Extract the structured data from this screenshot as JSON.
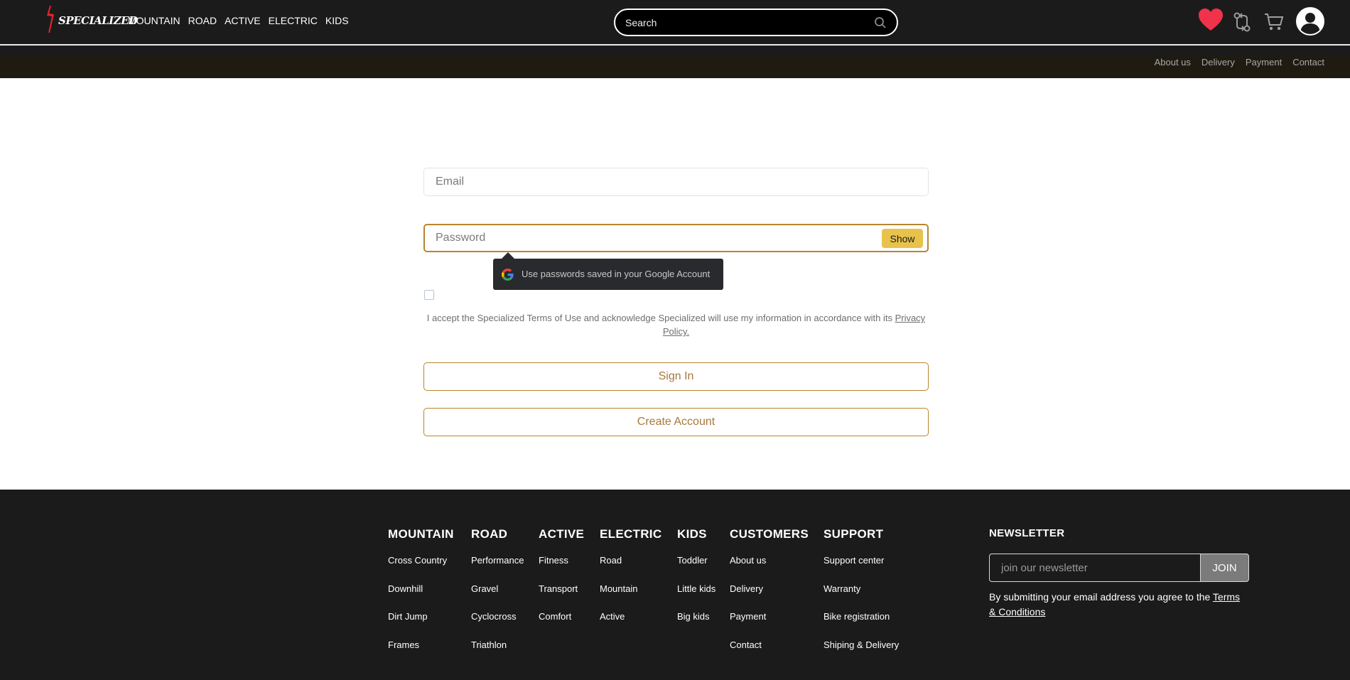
{
  "header": {
    "logo_text": "SPECIALIZED",
    "nav": [
      "MOUNTAIN",
      "ROAD",
      "ACTIVE",
      "ELECTRIC",
      "KIDS"
    ],
    "search_placeholder": "Search",
    "icons": [
      "heart-icon",
      "compare-icon",
      "cart-icon",
      "user-icon"
    ],
    "heart_color": "#f0324b"
  },
  "subnav": [
    "About us",
    "Delivery",
    "Payment",
    "Contact"
  ],
  "form": {
    "email_placeholder": "Email",
    "password_placeholder": "Password",
    "show_label": "Show",
    "tooltip_text": "Use passwords saved in your Google Account",
    "terms_text": "I accept the Specialized Terms of Use and acknowledge Specialized will use my information in accordance with its ",
    "privacy_link": "Privacy Policy.",
    "sign_in_label": "Sign In",
    "create_account_label": "Create Account",
    "accent_color": "#b8862c"
  },
  "footer": {
    "columns": [
      {
        "title": "MOUNTAIN",
        "links": [
          "Cross Country",
          "Downhill",
          "Dirt Jump",
          "Frames"
        ]
      },
      {
        "title": "ROAD",
        "links": [
          "Performance",
          "Gravel",
          "Cyclocross",
          "Triathlon"
        ]
      },
      {
        "title": "ACTIVE",
        "links": [
          "Fitness",
          "Transport",
          "Comfort"
        ]
      },
      {
        "title": "ELECTRIC",
        "links": [
          "Road",
          "Mountain",
          "Active"
        ]
      },
      {
        "title": "KIDS",
        "links": [
          "Toddler",
          "Little kids",
          "Big kids"
        ]
      },
      {
        "title": "CUSTOMERS",
        "links": [
          "About us",
          "Delivery",
          "Payment",
          "Contact"
        ]
      },
      {
        "title": "SUPPORT",
        "links": [
          "Support center",
          "Warranty",
          "Bike registration",
          "Shiping & Delivery"
        ]
      }
    ],
    "newsletter": {
      "title": "NEWSLETTER",
      "placeholder": "join our newsletter",
      "button": "JOIN",
      "note": "By submitting your email address you agree to the ",
      "terms_link": "Terms & Conditions"
    }
  }
}
